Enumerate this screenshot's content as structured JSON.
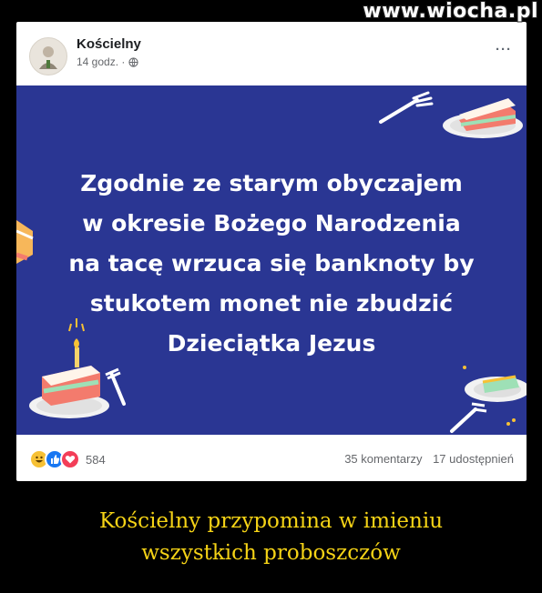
{
  "watermark": "www.wiocha.pl",
  "post": {
    "author": "Kościelny",
    "time": "14 godz. ·",
    "more": "···",
    "lines": [
      "Zgodnie ze starym obyczajem",
      "w okresie Bożego Narodzenia",
      "na tacę wrzuca się banknoty by",
      "stukotem monet nie zbudzić",
      "Dzieciątka Jezus"
    ],
    "background_color": "#2a3693",
    "reactions_count": "584",
    "comments": "35 komentarzy",
    "shares": "17 udostępnień",
    "reaction_icons": [
      "haha-icon",
      "like-icon",
      "love-icon"
    ]
  },
  "caption": {
    "line1": "Kościelny przypomina w imieniu",
    "line2": "wszystkich proboszczów"
  }
}
